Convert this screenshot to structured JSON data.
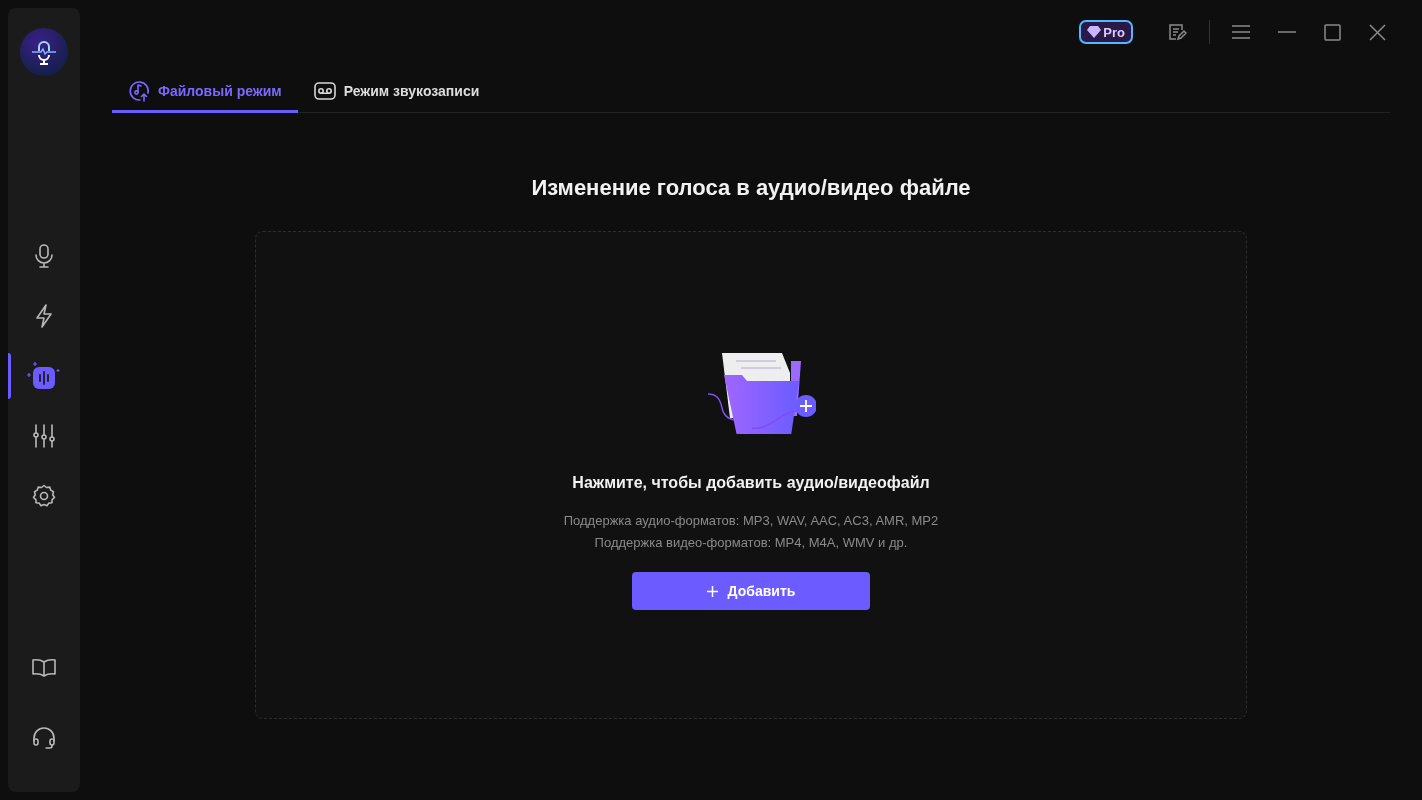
{
  "sidebar": {
    "nav": [
      {
        "kind": "mic",
        "selected": false
      },
      {
        "kind": "bolt",
        "selected": false
      },
      {
        "kind": "voice",
        "selected": true
      },
      {
        "kind": "sliders",
        "selected": false
      },
      {
        "kind": "gear",
        "selected": false
      }
    ],
    "bottom": [
      {
        "kind": "book"
      },
      {
        "kind": "headset"
      }
    ]
  },
  "titlebar": {
    "badge": "Pro"
  },
  "tabs": [
    {
      "label": "Файловый режим",
      "kind": "file",
      "selected": true
    },
    {
      "label": "Режим звукозаписи",
      "kind": "record",
      "selected": false
    }
  ],
  "heading": "Изменение голоса в аудио/видео файле",
  "dropzone": {
    "prompt": "Нажмите, чтобы добавить аудио/видеофайл",
    "formats": [
      "Поддержка аудио-форматов: MP3, WAV, AAC, AC3, AMR, MP2",
      "Поддержка видео-форматов: MP4, M4A, WMV и др."
    ],
    "button": "Добавить"
  }
}
